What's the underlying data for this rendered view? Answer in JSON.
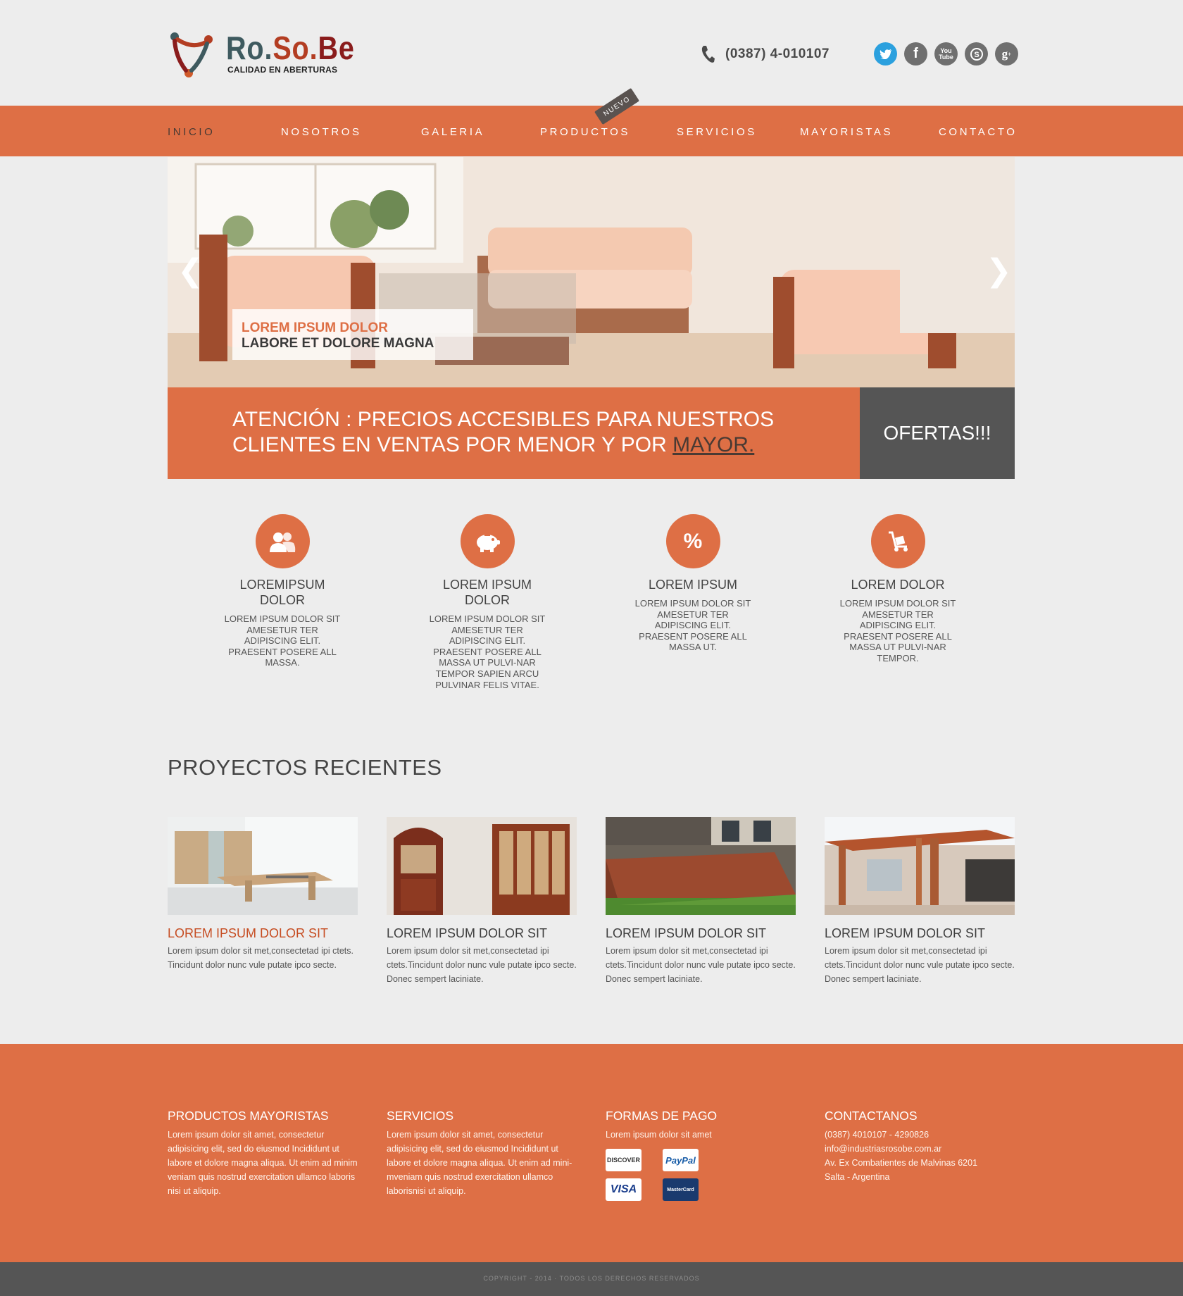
{
  "brand": {
    "name_part1": "Ro.",
    "name_part2": "So.",
    "name_part3": "Be",
    "tagline": "CALIDAD EN ABERTURAS"
  },
  "header": {
    "phone": "(0387) 4-010107",
    "social": [
      "twitter-icon",
      "facebook-icon",
      "youtube-icon",
      "skype-icon",
      "google-plus-icon"
    ]
  },
  "nav": {
    "items": [
      {
        "label": "INICIO"
      },
      {
        "label": "NOSOTROS"
      },
      {
        "label": "GALERIA"
      },
      {
        "label": "PRODUCTOS"
      },
      {
        "label": "SERVICIOS"
      },
      {
        "label": "MAYORISTAS"
      },
      {
        "label": "CONTACTO"
      }
    ],
    "badge": "NUEVO"
  },
  "slider": {
    "caption_line1": "LOREM IPSUM DOLOR",
    "caption_line2": "LABORE ET DOLORE MAGNA",
    "prev": "❮",
    "next": "❯"
  },
  "banner": {
    "text": "ATENCIÓN :  PRECIOS ACCESIBLES PARA NUESTROS CLIENTES EN VENTAS POR MENOR Y POR",
    "link": "MAYOR.",
    "offers": "OFERTAS!!!"
  },
  "features": [
    {
      "icon": "users-icon",
      "title": "LOREMIPSUM DOLOR",
      "text": "LOREM IPSUM DOLOR SIT AMESETUR TER ADIPISCING ELIT. PRAESENT POSERE ALL MASSA."
    },
    {
      "icon": "piggy-bank-icon",
      "title": "LOREM IPSUM DOLOR",
      "text": "LOREM IPSUM DOLOR SIT AMESETUR TER ADIPISCING ELIT. PRAESENT POSERE ALL MASSA UT PULVI-NAR TEMPOR SAPIEN ARCU PULVINAR FELIS VITAE."
    },
    {
      "icon": "percent-icon",
      "title": "LOREM IPSUM",
      "text": "LOREM IPSUM DOLOR SIT AMESETUR TER ADIPISCING ELIT. PRAESENT POSERE ALL MASSA UT."
    },
    {
      "icon": "hand-truck-icon",
      "title": "LOREM DOLOR",
      "text": "LOREM IPSUM DOLOR SIT AMESETUR TER ADIPISCING ELIT. PRAESENT POSERE ALL MASSA UT PULVI-NAR TEMPOR."
    }
  ],
  "projects": {
    "title": "PROYECTOS RECIENTES",
    "items": [
      {
        "title": "LOREM IPSUM DOLOR SIT",
        "text": "Lorem ipsum dolor sit met,consectetad ipi ctets. Tincidunt dolor nunc vule putate ipco secte."
      },
      {
        "title": "LOREM IPSUM DOLOR SIT",
        "text": "Lorem ipsum dolor sit met,consectetad ipi ctets.Tincidunt dolor nunc vule putate ipco secte. Donec sempert laciniate."
      },
      {
        "title": "LOREM IPSUM DOLOR SIT",
        "text": "Lorem ipsum dolor sit met,consectetad ipi ctets.Tincidunt dolor nunc vule putate ipco secte. Donec sempert laciniate."
      },
      {
        "title": "LOREM IPSUM DOLOR SIT",
        "text": "Lorem ipsum dolor sit met,consectetad ipi ctets.Tincidunt dolor nunc vule putate ipco secte. Donec sempert laciniate."
      }
    ]
  },
  "footer": {
    "col1": {
      "title": "PRODUCTOS MAYORISTAS",
      "text": "Lorem ipsum dolor sit amet, consectetur adipisicing elit, sed do eiusmod Incididunt ut labore et dolore magna aliqua. Ut enim ad minim veniam quis nostrud exercitation ullamco laboris nisi ut aliquip."
    },
    "col2": {
      "title": "SERVICIOS",
      "text": "Lorem ipsum dolor sit amet, consectetur adipisicing elit, sed do eiusmod Incididunt ut labore et dolore magna aliqua. Ut enim ad mini-mveniam quis nostrud exercitation ullamco laborisnisi ut aliquip."
    },
    "col3": {
      "title": "FORMAS DE PAGO",
      "text": "Lorem ipsum dolor sit amet",
      "cards": [
        "DISCOVER",
        "PayPal",
        "VISA",
        "MasterCard"
      ]
    },
    "col4": {
      "title": "CONTACTANOS",
      "phone": "(0387) 4010107 - 4290826",
      "email": "info@industriasrosobe.com.ar",
      "address": "Av. Ex Combatientes de Malvinas 6201",
      "city": "Salta - Argentina"
    },
    "copyright": "COPYRIGHT - 2014 · TODOS LOS DERECHOS RESERVADOS"
  },
  "colors": {
    "accent": "#de6f45",
    "dark": "#555555",
    "background": "#ededed"
  }
}
